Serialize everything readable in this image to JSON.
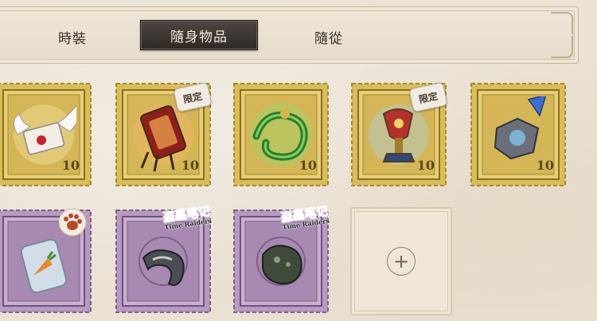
{
  "tabs": [
    {
      "label": "時裝",
      "active": false
    },
    {
      "label": "隨身物品",
      "active": true
    },
    {
      "label": "隨從",
      "active": false
    }
  ],
  "items": [
    {
      "name": "winged-letter",
      "rarity": "gold",
      "value": "10",
      "badge": null
    },
    {
      "name": "ornate-lantern",
      "rarity": "gold",
      "value": "10",
      "badge": "限定"
    },
    {
      "name": "jade-dragon",
      "rarity": "gold",
      "value": "10",
      "badge": null
    },
    {
      "name": "jeweled-chalice",
      "rarity": "gold",
      "value": "10",
      "badge": "限定"
    },
    {
      "name": "crystal-puzzle",
      "rarity": "gold",
      "value": "10",
      "badge": null
    },
    {
      "name": "carrot-jar",
      "rarity": "purple",
      "value": "",
      "badge": "paw"
    },
    {
      "name": "fossil-claw",
      "rarity": "purple",
      "value": "",
      "badge": "盗墓笔记"
    },
    {
      "name": "stone-beast",
      "rarity": "purple",
      "value": "",
      "badge": "盗墓笔记"
    }
  ],
  "badges": {
    "limited": "限定",
    "raiders_cn": "盗墓笔记",
    "raiders_en": "Time Raiders"
  },
  "empty_slot": {
    "icon": "plus-icon",
    "symbol": "+"
  },
  "colors": {
    "background": "#ebe2d4",
    "tab_active_bg": "#2e2924",
    "gold_frame": "#c9a83e",
    "purple_frame": "#a889b2"
  }
}
